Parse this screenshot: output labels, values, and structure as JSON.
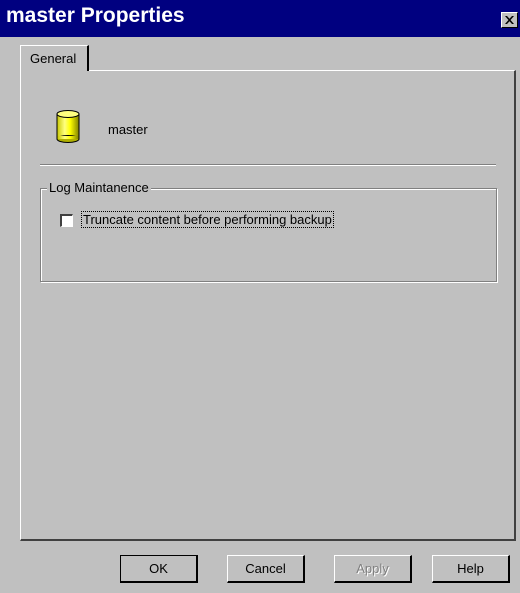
{
  "window": {
    "title": "master Properties",
    "title_bar_color": "#000080",
    "face_color": "#c0c0c0",
    "close_icon": "close-icon"
  },
  "tabs": [
    {
      "label": "General",
      "selected": true
    }
  ],
  "general": {
    "database_icon": "database-cylinder-icon",
    "database_icon_color": "#ffff00",
    "database_name": "master",
    "log_group": {
      "label": "Log Maintanence",
      "truncate_checkbox": {
        "label": "Truncate content before performing backup",
        "checked": false
      }
    }
  },
  "buttons": {
    "ok": "OK",
    "cancel": "Cancel",
    "apply": "Apply",
    "help": "Help"
  }
}
